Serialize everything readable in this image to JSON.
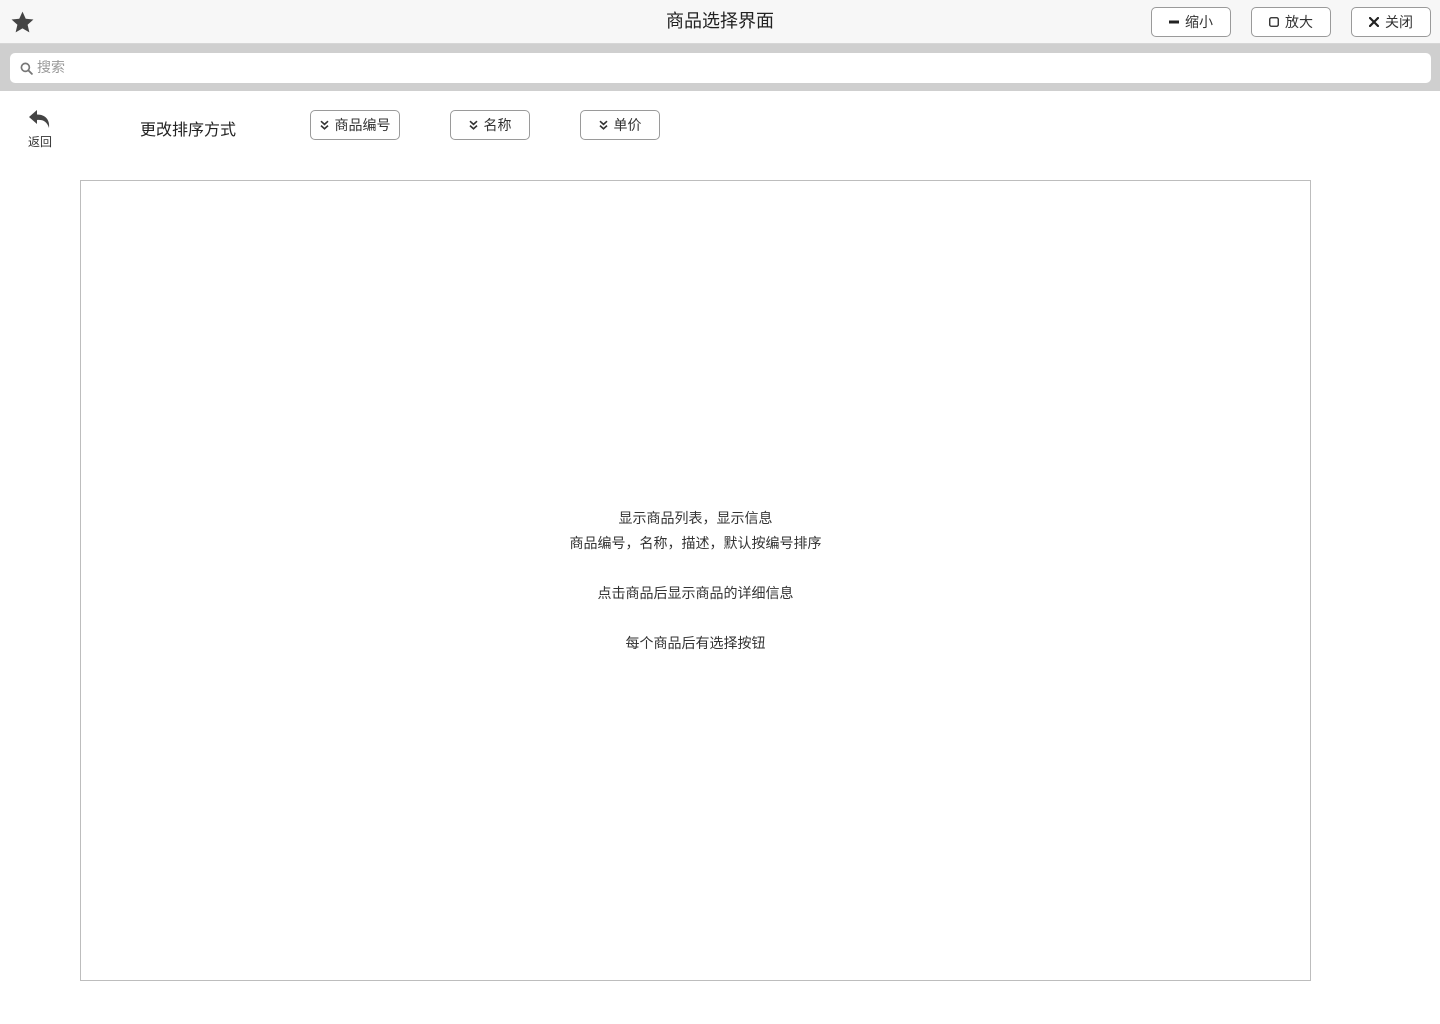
{
  "window": {
    "title": "商品选择界面",
    "buttons": {
      "minimize_label": "缩小",
      "maximize_label": "放大",
      "close_label": "关闭"
    }
  },
  "search": {
    "placeholder": "搜索",
    "value": ""
  },
  "toolbar": {
    "back_label": "返回",
    "sort_label": "更改排序方式",
    "sort_buttons": [
      {
        "label": "商品编号",
        "icon": "double-chevron-down-icon"
      },
      {
        "label": "名称",
        "icon": "double-chevron-down-icon"
      },
      {
        "label": "单价",
        "icon": "double-chevron-down-icon"
      }
    ]
  },
  "list_panel": {
    "notes": [
      "显示商品列表，显示信息",
      "商品编号，名称，描述，默认按编号排序",
      "点击商品后显示商品的详细信息",
      "每个商品后有选择按钮"
    ]
  },
  "colors": {
    "titlebar_bg": "#f7f7f7",
    "searchbar_bg": "#cfcfcf",
    "icon": "#444444",
    "border": "#9a9a9a"
  }
}
